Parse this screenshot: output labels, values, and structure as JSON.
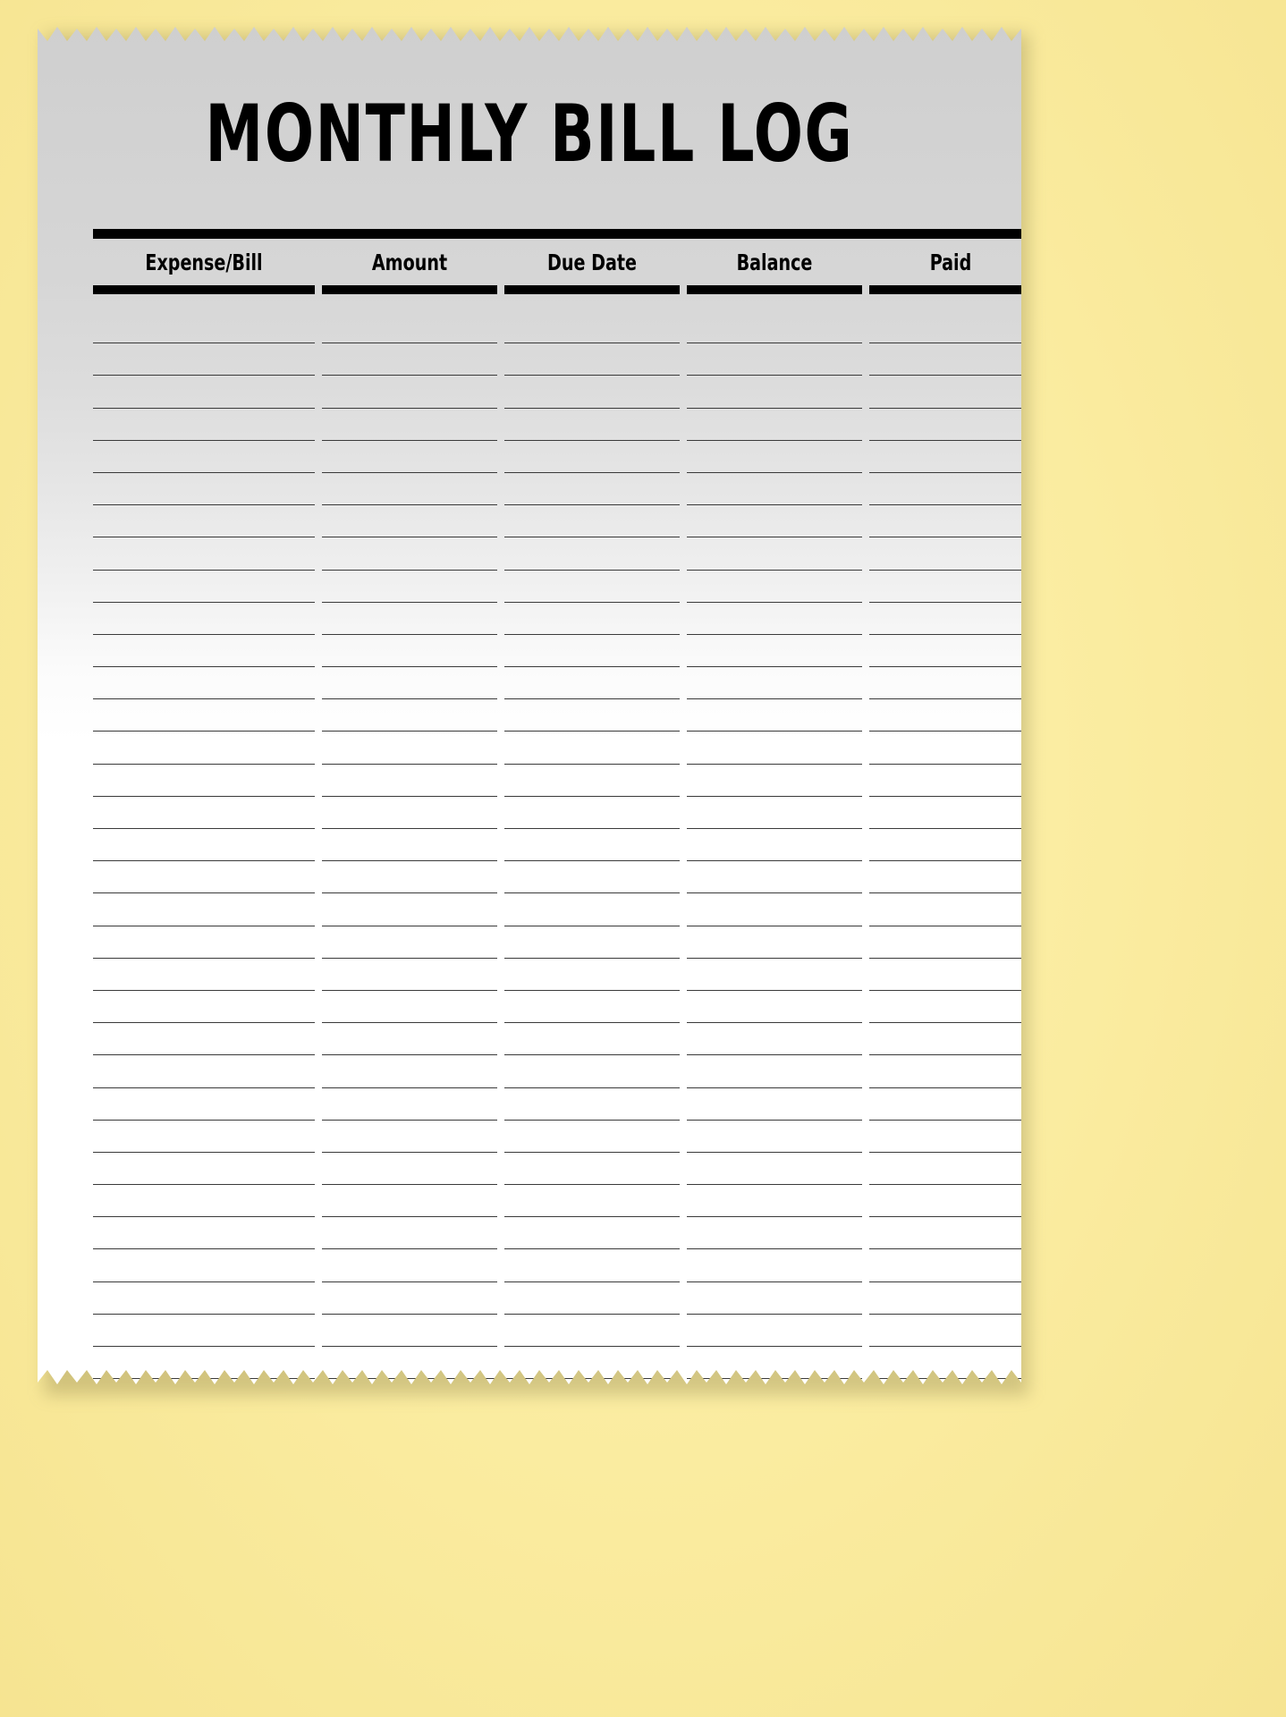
{
  "page": {
    "title": "MONTHLY BILL LOG",
    "background_color": "#faeda0",
    "paper_color_top": "#cfcfcf",
    "paper_color_bottom": "#ffffff",
    "ink_color": "#000000",
    "rule_color": "#3a3a3a"
  },
  "table": {
    "columns": [
      {
        "key": "expense_bill",
        "label": "Expense/Bill"
      },
      {
        "key": "amount",
        "label": "Amount"
      },
      {
        "key": "due_date",
        "label": "Due Date"
      },
      {
        "key": "balance",
        "label": "Balance"
      },
      {
        "key": "paid",
        "label": "Paid"
      }
    ],
    "blank_row_count": 33,
    "rows": []
  }
}
